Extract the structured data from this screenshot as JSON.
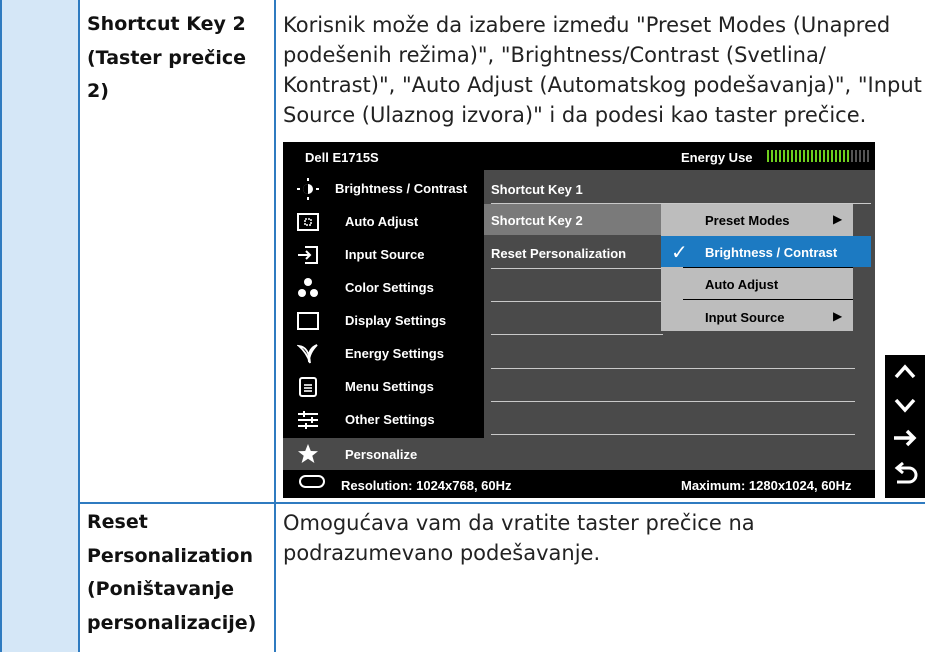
{
  "rows": [
    {
      "label": "Shortcut Key 2\n(Taster prečice 2)",
      "label_line1": "Shortcut Key 2",
      "label_line2": "(Taster prečice 2)",
      "desc_lines": [
        "Korisnik može da izabere između \"Preset Modes (Unapred",
        "podešenih režima)\", \"Brightness/Contrast (Svetlina/",
        "Kontrast)\", \"Auto Adjust (Automatskog podešavanja)\", \"Input",
        "Source (Ulaznog izvora)\" i da podesi kao taster prečice."
      ]
    },
    {
      "label_lines": [
        "Reset",
        "Personalization",
        "(Poništavanje",
        "personalizacije)"
      ],
      "desc_lines": [
        "Omogućava vam da vratite taster prečice na",
        "podrazumevano podešavanje."
      ]
    }
  ],
  "osd": {
    "model": "Dell E1715S",
    "energy_label": "Energy Use",
    "menu": [
      {
        "label": "Brightness / Contrast",
        "icon": "brightness-icon"
      },
      {
        "label": "Auto Adjust",
        "icon": "auto-adjust-icon"
      },
      {
        "label": "Input Source",
        "icon": "input-source-icon"
      },
      {
        "label": "Color Settings",
        "icon": "color-settings-icon"
      },
      {
        "label": "Display Settings",
        "icon": "display-settings-icon"
      },
      {
        "label": "Energy Settings",
        "icon": "energy-settings-icon"
      },
      {
        "label": "Menu Settings",
        "icon": "menu-settings-icon"
      },
      {
        "label": "Other Settings",
        "icon": "other-settings-icon"
      },
      {
        "label": "Personalize",
        "icon": "star-icon",
        "selected": true
      }
    ],
    "submenu": [
      {
        "label": "Shortcut Key 1"
      },
      {
        "label": "Shortcut Key 2",
        "selected": true
      },
      {
        "label": "Reset Personalization"
      }
    ],
    "options": [
      {
        "label": "Preset Modes",
        "arrow": true
      },
      {
        "label": "Brightness / Contrast",
        "checked": true
      },
      {
        "label": "Auto Adjust"
      },
      {
        "label": "Input Source",
        "arrow": true
      }
    ],
    "resolution": "Resolution: 1024x768, 60Hz",
    "maximum": "Maximum: 1280x1024, 60Hz"
  },
  "nav_buttons": [
    "up-arrow-icon",
    "down-arrow-icon",
    "right-arrow-icon",
    "back-icon"
  ],
  "colors": {
    "table_border": "#2f7bc0",
    "left_cell": "#d5e7f7",
    "highlight": "#1c7ac2",
    "osd_bg": "#000000"
  }
}
